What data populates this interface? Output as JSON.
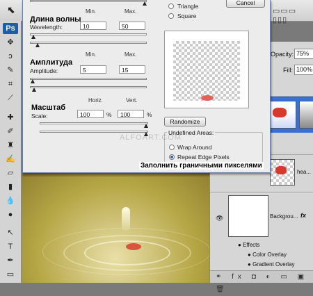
{
  "photoshop": {
    "logo": "Ps",
    "layers_panel": {
      "opacity_label": "Opacity:",
      "opacity_value": "75%",
      "fill_label": "Fill:",
      "fill_value": "100%",
      "layer2_name": "hea...",
      "background_layer_name": "Backgrou...",
      "fx_badge": "fx",
      "effects_label": "Effects",
      "color_overlay_label": "Color Overlay",
      "gradient_overlay_label": "Gradient Overlay",
      "bottom_icons": "⚭ fx ◘ ◐ ▭ ▣ 🗑"
    }
  },
  "dialog": {
    "cancel_label": "Cancel",
    "triangle_label": "Triangle",
    "square_label": "Square",
    "wavelength": {
      "ru_label": "Длина волны",
      "en_label": "Wavelength:",
      "min_header": "Min.",
      "max_header": "Max.",
      "min": "10",
      "max": "50"
    },
    "amplitude": {
      "ru_label": "Амплитуда",
      "en_label": "Amplitude:",
      "min_header": "Min.",
      "max_header": "Max.",
      "min": "5",
      "max": "15"
    },
    "scale": {
      "ru_label": "Масштаб",
      "en_label": "Scale:",
      "horiz_header": "Horiz.",
      "vert_header": "Vert.",
      "horiz": "100",
      "vert": "100",
      "percent": "%"
    },
    "randomize_label": "Randomize",
    "undefined_areas": {
      "title": "Undefined Areas:",
      "wrap_label": "Wrap Around",
      "repeat_label": "Repeat Edge Pixels",
      "selected": "repeat"
    },
    "watermark": "ALFOART.COM",
    "caption_ru": "Заполнить граничными пикселями"
  }
}
